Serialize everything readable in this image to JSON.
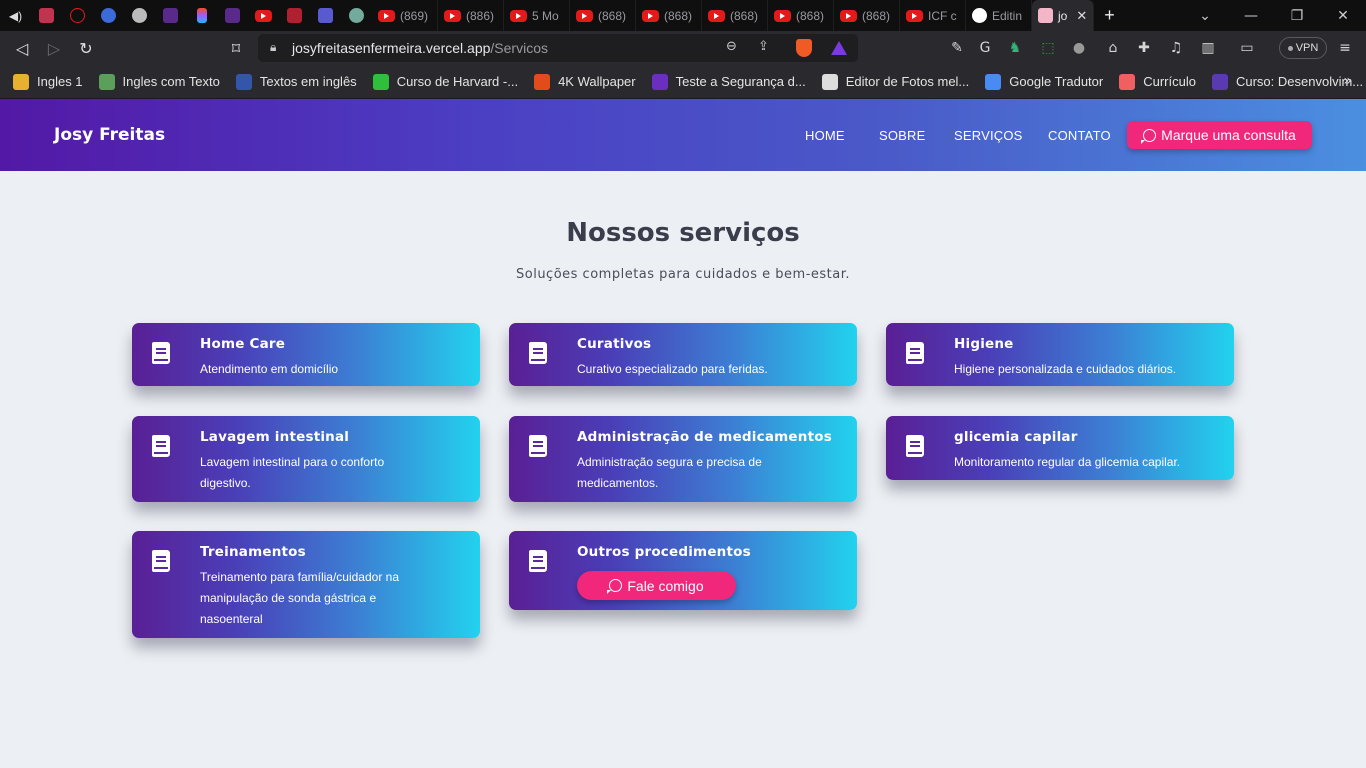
{
  "browser": {
    "tabs": [
      {
        "icon": "speaker-icon",
        "title": ""
      },
      {
        "icon": "app-icon",
        "title": ""
      },
      {
        "icon": "play-circle-icon",
        "title": ""
      },
      {
        "icon": "app-icon",
        "title": ""
      },
      {
        "icon": "app-icon",
        "title": ""
      },
      {
        "icon": "app-icon",
        "title": ""
      },
      {
        "icon": "figma-icon",
        "title": ""
      },
      {
        "icon": "app-icon",
        "title": ""
      },
      {
        "icon": "youtube-icon",
        "title": ""
      },
      {
        "icon": "app-icon",
        "title": ""
      },
      {
        "icon": "app-icon",
        "title": ""
      },
      {
        "icon": "openai-icon",
        "title": ""
      },
      {
        "icon": "youtube-icon",
        "title": "(869)"
      },
      {
        "icon": "youtube-icon",
        "title": "(886)"
      },
      {
        "icon": "youtube-icon",
        "title": "5 Mo"
      },
      {
        "icon": "youtube-icon",
        "title": "(868)"
      },
      {
        "icon": "youtube-icon",
        "title": "(868)"
      },
      {
        "icon": "youtube-icon",
        "title": "(868)"
      },
      {
        "icon": "youtube-icon",
        "title": "(868)"
      },
      {
        "icon": "youtube-icon",
        "title": "(868)"
      },
      {
        "icon": "youtube-icon",
        "title": "ICF c"
      },
      {
        "icon": "github-icon",
        "title": "Editin"
      },
      {
        "icon": "site-icon",
        "title": "jo"
      }
    ],
    "url_host": "josyfreitasenfermeira.vercel.app",
    "url_path": "/Servicos",
    "vpn_label": "VPN",
    "bookmarks": [
      {
        "label": "Ingles 1",
        "color": "#E8B030"
      },
      {
        "label": "Ingles com Texto",
        "color": "#5BA05A"
      },
      {
        "label": "Textos em inglês",
        "color": "#3355AA"
      },
      {
        "label": "Curso de Harvard -...",
        "color": "#2FBF3A"
      },
      {
        "label": "4K Wallpaper",
        "color": "#E24B1A"
      },
      {
        "label": "Teste a Segurança d...",
        "color": "#6A2FC0"
      },
      {
        "label": "Editor de Fotos mel...",
        "color": "#DDDDDD"
      },
      {
        "label": "Google Tradutor",
        "color": "#4A8AF4"
      },
      {
        "label": "Currículo",
        "color": "#F06060"
      },
      {
        "label": "Curso: Desenvolvim...",
        "color": "#5A3AB0"
      }
    ]
  },
  "site": {
    "brand": "Josy Freitas",
    "nav": [
      "HOME",
      "SOBRE",
      "SERVIÇOS",
      "CONTATO"
    ],
    "cta_label": "Marque uma consulta"
  },
  "services": {
    "title": "Nossos serviços",
    "subtitle": "Soluções completas para cuidados e bem-estar.",
    "cards": [
      {
        "title": "Home Care",
        "desc": "Atendimento em domicílio"
      },
      {
        "title": "Curativos",
        "desc": "Curativo especializado para feridas."
      },
      {
        "title": "Higiene",
        "desc": "Higiene personalizada e cuidados diários."
      },
      {
        "title": "Lavagem intestinal",
        "desc": "Lavagem intestinal para o conforto digestivo."
      },
      {
        "title": "Administração de medicamentos",
        "desc": "Administração segura e precisa de medicamentos."
      },
      {
        "title": "glicemia capilar",
        "desc": "Monitoramento regular da glicemia capilar."
      },
      {
        "title": "Treinamentos",
        "desc": "Treinamento para família/cuidador na manipulação de sonda gástrica e nasoenteral"
      },
      {
        "title": "Outros procedimentos",
        "button": "Fale comigo"
      }
    ]
  },
  "colors": {
    "accent_pink": "#F0277B",
    "header_start": "#5318A6",
    "header_end": "#4B8FE0",
    "card_start": "#5A1F95",
    "card_end": "#22D2EE"
  }
}
